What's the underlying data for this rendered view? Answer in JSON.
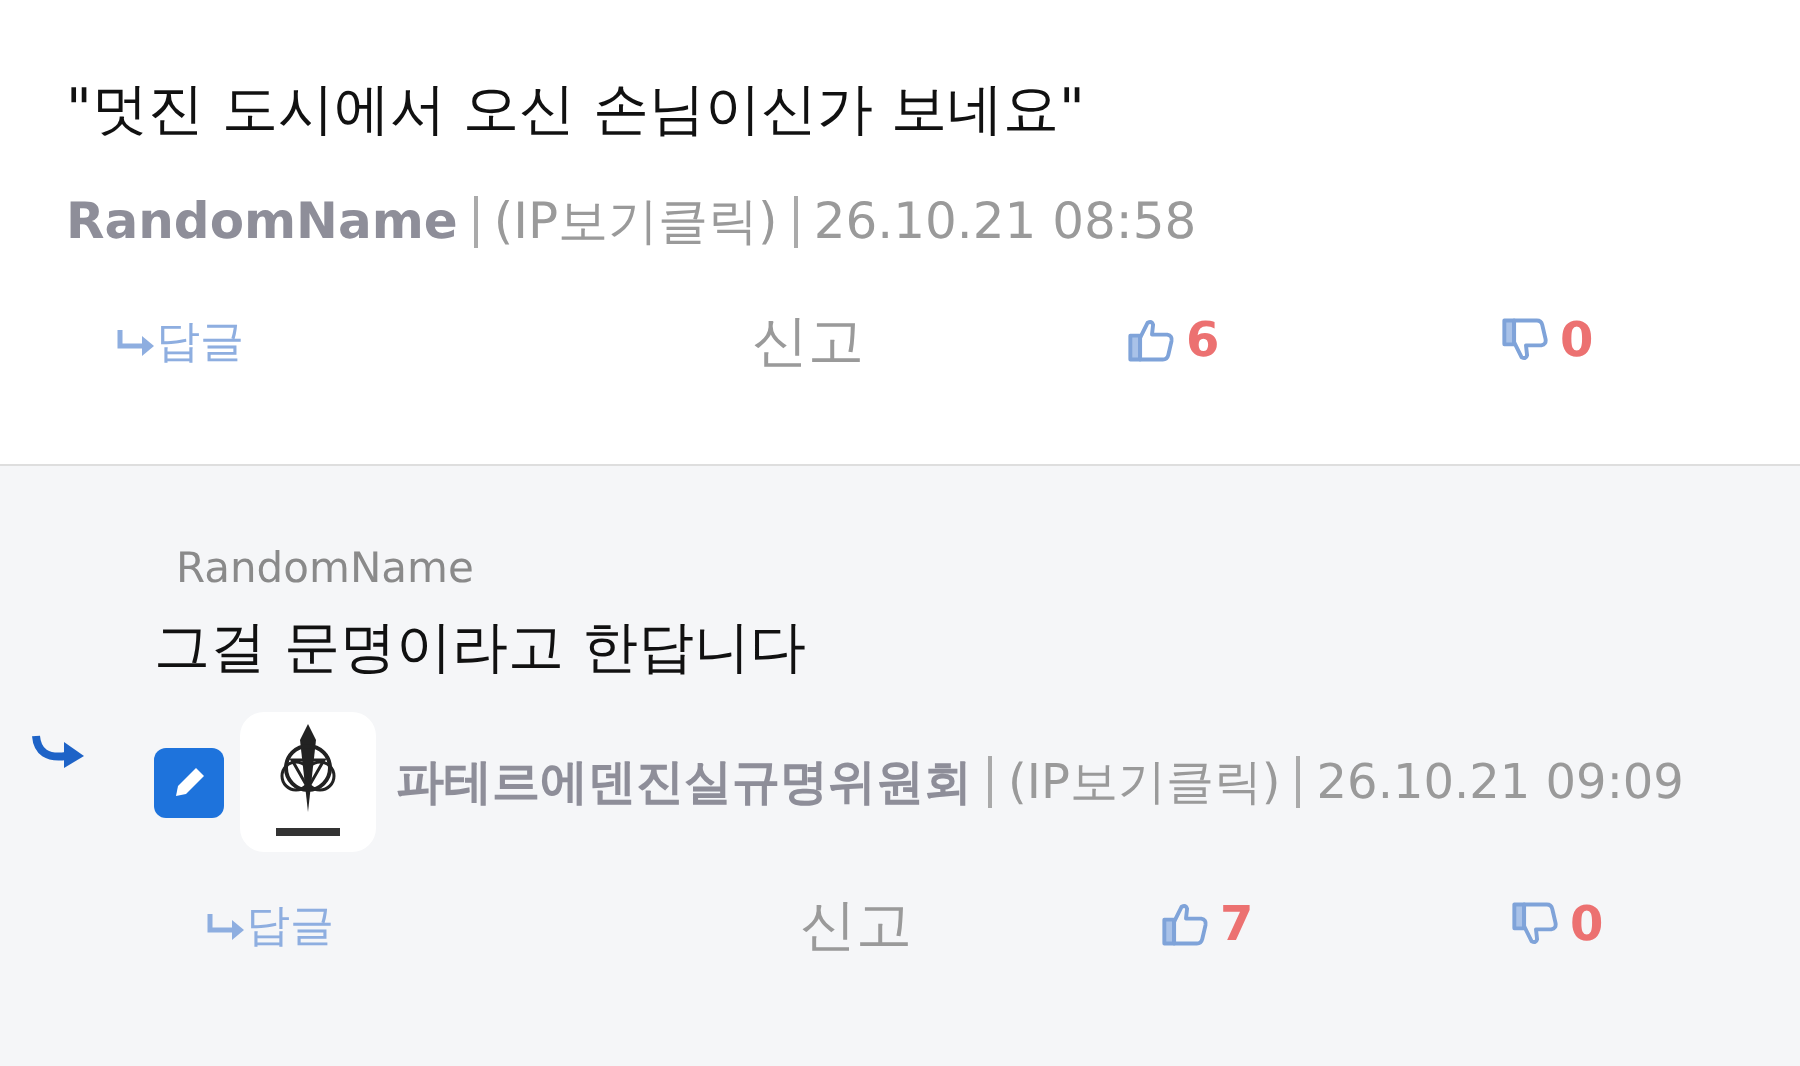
{
  "comment": {
    "text": "\"멋진 도시에서 오신 손님이신가 보네요\"",
    "author": "RandomName",
    "ip": "(IP보기클릭)",
    "time": "26.10.21 08:58",
    "reply_label": "답글",
    "report_label": "신고",
    "likes": "6",
    "dislikes": "0"
  },
  "reply": {
    "quoted_author": "RandomName",
    "text": "그걸 문명이라고 한답니다",
    "author": "파테르에덴진실규명위원회",
    "ip": "(IP보기클릭)",
    "time": "26.10.21 09:09",
    "reply_label": "답글",
    "report_label": "신고",
    "likes": "7",
    "dislikes": "0"
  }
}
